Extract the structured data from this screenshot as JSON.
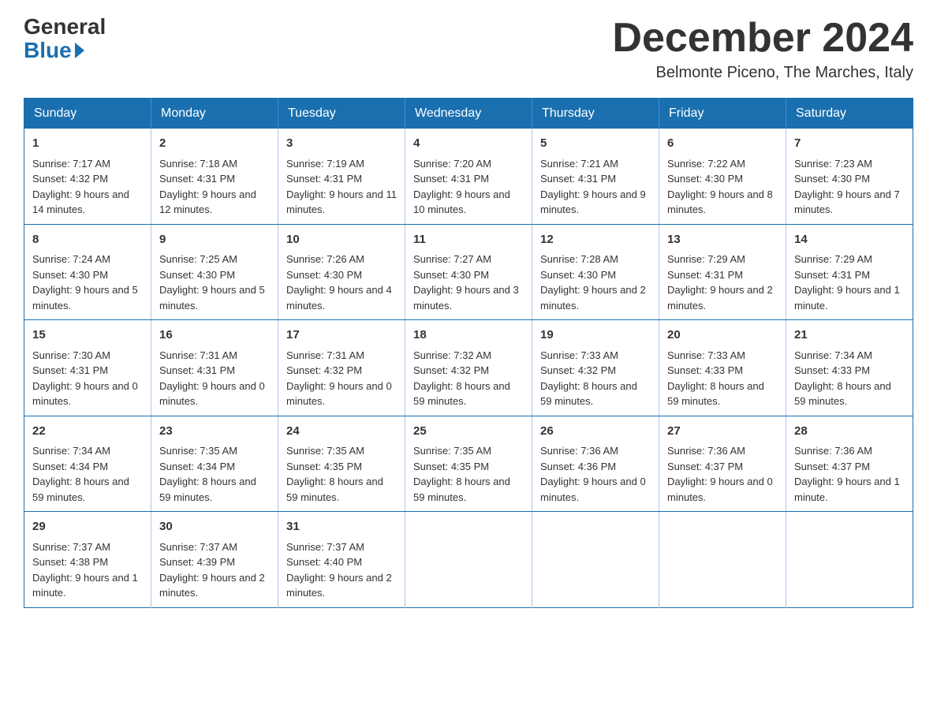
{
  "logo": {
    "general": "General",
    "blue": "Blue"
  },
  "title": "December 2024",
  "location": "Belmonte Piceno, The Marches, Italy",
  "days_of_week": [
    "Sunday",
    "Monday",
    "Tuesday",
    "Wednesday",
    "Thursday",
    "Friday",
    "Saturday"
  ],
  "weeks": [
    [
      {
        "day": "1",
        "sunrise": "7:17 AM",
        "sunset": "4:32 PM",
        "daylight": "9 hours and 14 minutes."
      },
      {
        "day": "2",
        "sunrise": "7:18 AM",
        "sunset": "4:31 PM",
        "daylight": "9 hours and 12 minutes."
      },
      {
        "day": "3",
        "sunrise": "7:19 AM",
        "sunset": "4:31 PM",
        "daylight": "9 hours and 11 minutes."
      },
      {
        "day": "4",
        "sunrise": "7:20 AM",
        "sunset": "4:31 PM",
        "daylight": "9 hours and 10 minutes."
      },
      {
        "day": "5",
        "sunrise": "7:21 AM",
        "sunset": "4:31 PM",
        "daylight": "9 hours and 9 minutes."
      },
      {
        "day": "6",
        "sunrise": "7:22 AM",
        "sunset": "4:30 PM",
        "daylight": "9 hours and 8 minutes."
      },
      {
        "day": "7",
        "sunrise": "7:23 AM",
        "sunset": "4:30 PM",
        "daylight": "9 hours and 7 minutes."
      }
    ],
    [
      {
        "day": "8",
        "sunrise": "7:24 AM",
        "sunset": "4:30 PM",
        "daylight": "9 hours and 5 minutes."
      },
      {
        "day": "9",
        "sunrise": "7:25 AM",
        "sunset": "4:30 PM",
        "daylight": "9 hours and 5 minutes."
      },
      {
        "day": "10",
        "sunrise": "7:26 AM",
        "sunset": "4:30 PM",
        "daylight": "9 hours and 4 minutes."
      },
      {
        "day": "11",
        "sunrise": "7:27 AM",
        "sunset": "4:30 PM",
        "daylight": "9 hours and 3 minutes."
      },
      {
        "day": "12",
        "sunrise": "7:28 AM",
        "sunset": "4:30 PM",
        "daylight": "9 hours and 2 minutes."
      },
      {
        "day": "13",
        "sunrise": "7:29 AM",
        "sunset": "4:31 PM",
        "daylight": "9 hours and 2 minutes."
      },
      {
        "day": "14",
        "sunrise": "7:29 AM",
        "sunset": "4:31 PM",
        "daylight": "9 hours and 1 minute."
      }
    ],
    [
      {
        "day": "15",
        "sunrise": "7:30 AM",
        "sunset": "4:31 PM",
        "daylight": "9 hours and 0 minutes."
      },
      {
        "day": "16",
        "sunrise": "7:31 AM",
        "sunset": "4:31 PM",
        "daylight": "9 hours and 0 minutes."
      },
      {
        "day": "17",
        "sunrise": "7:31 AM",
        "sunset": "4:32 PM",
        "daylight": "9 hours and 0 minutes."
      },
      {
        "day": "18",
        "sunrise": "7:32 AM",
        "sunset": "4:32 PM",
        "daylight": "8 hours and 59 minutes."
      },
      {
        "day": "19",
        "sunrise": "7:33 AM",
        "sunset": "4:32 PM",
        "daylight": "8 hours and 59 minutes."
      },
      {
        "day": "20",
        "sunrise": "7:33 AM",
        "sunset": "4:33 PM",
        "daylight": "8 hours and 59 minutes."
      },
      {
        "day": "21",
        "sunrise": "7:34 AM",
        "sunset": "4:33 PM",
        "daylight": "8 hours and 59 minutes."
      }
    ],
    [
      {
        "day": "22",
        "sunrise": "7:34 AM",
        "sunset": "4:34 PM",
        "daylight": "8 hours and 59 minutes."
      },
      {
        "day": "23",
        "sunrise": "7:35 AM",
        "sunset": "4:34 PM",
        "daylight": "8 hours and 59 minutes."
      },
      {
        "day": "24",
        "sunrise": "7:35 AM",
        "sunset": "4:35 PM",
        "daylight": "8 hours and 59 minutes."
      },
      {
        "day": "25",
        "sunrise": "7:35 AM",
        "sunset": "4:35 PM",
        "daylight": "8 hours and 59 minutes."
      },
      {
        "day": "26",
        "sunrise": "7:36 AM",
        "sunset": "4:36 PM",
        "daylight": "9 hours and 0 minutes."
      },
      {
        "day": "27",
        "sunrise": "7:36 AM",
        "sunset": "4:37 PM",
        "daylight": "9 hours and 0 minutes."
      },
      {
        "day": "28",
        "sunrise": "7:36 AM",
        "sunset": "4:37 PM",
        "daylight": "9 hours and 1 minute."
      }
    ],
    [
      {
        "day": "29",
        "sunrise": "7:37 AM",
        "sunset": "4:38 PM",
        "daylight": "9 hours and 1 minute."
      },
      {
        "day": "30",
        "sunrise": "7:37 AM",
        "sunset": "4:39 PM",
        "daylight": "9 hours and 2 minutes."
      },
      {
        "day": "31",
        "sunrise": "7:37 AM",
        "sunset": "4:40 PM",
        "daylight": "9 hours and 2 minutes."
      },
      null,
      null,
      null,
      null
    ]
  ]
}
